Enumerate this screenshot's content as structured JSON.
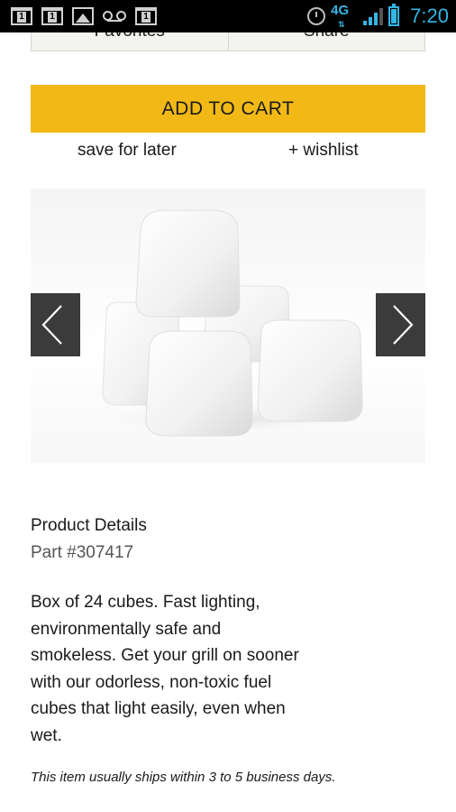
{
  "status_bar": {
    "notification_icons": [
      "notification-1-icon",
      "notification-1-icon",
      "gallery-icon",
      "voicemail-icon",
      "notification-1-icon"
    ],
    "notification_badge": "1",
    "network_type": "4G",
    "time": "7:20",
    "accent_color": "#33b5e5"
  },
  "top_buttons": {
    "favorites_label": "Favorites",
    "share_label": "Share"
  },
  "cart": {
    "add_to_cart_label": "ADD TO CART",
    "button_color": "#f2b916",
    "save_for_later_label": "save for later",
    "wishlist_label": "+ wishlist"
  },
  "carousel": {
    "prev_icon": "chevron-left-icon",
    "next_icon": "chevron-right-icon"
  },
  "product": {
    "details_heading": "Product Details",
    "part_number": "Part #307417",
    "description": "Box of 24 cubes. Fast lighting, environmentally safe and smokeless. Get your grill on sooner with our odorless, non-toxic fuel cubes that light easily, even when wet.",
    "shipping_note": "This item usually ships within 3 to 5 business days."
  }
}
